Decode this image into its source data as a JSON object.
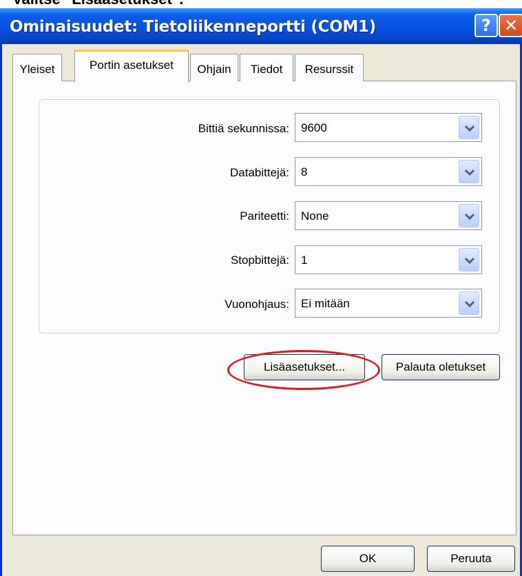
{
  "caption": "Valitse \"Lisäasetukset\".",
  "window": {
    "title": "Ominaisuudet: Tietoliikenneportti (COM1)",
    "help_glyph": "?",
    "close_glyph": "✕"
  },
  "tabs": [
    {
      "label": "Yleiset",
      "active": false
    },
    {
      "label": "Portin asetukset",
      "active": true
    },
    {
      "label": "Ohjain",
      "active": false
    },
    {
      "label": "Tiedot",
      "active": false
    },
    {
      "label": "Resurssit",
      "active": false
    }
  ],
  "settings": [
    {
      "label": "Bittiä sekunnissa:",
      "value": "9600"
    },
    {
      "label": "Databittejä:",
      "value": "8"
    },
    {
      "label": "Pariteetti:",
      "value": "None"
    },
    {
      "label": "Stopbittejä:",
      "value": "1"
    },
    {
      "label": "Vuonohjaus:",
      "value": "Ei mitään"
    }
  ],
  "buttons": {
    "advanced": "Lisäasetukset...",
    "restore_defaults": "Palauta oletukset",
    "ok": "OK",
    "cancel": "Peruuta"
  },
  "colors": {
    "titlebar": "#0654E2",
    "highlight": "#E8141C",
    "active_tab_accent": "#FFC83C"
  }
}
